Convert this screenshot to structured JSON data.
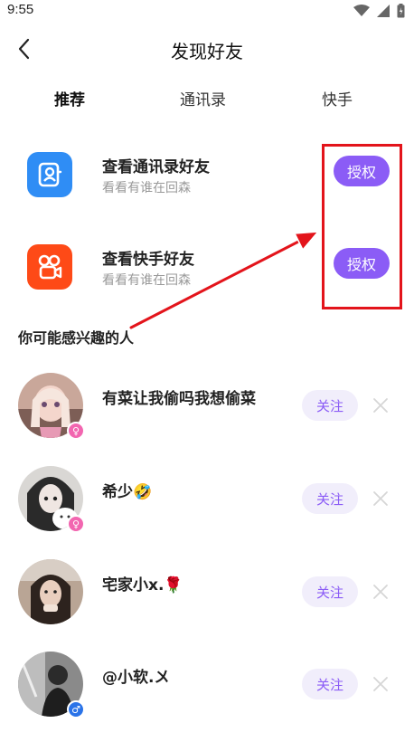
{
  "status_bar": {
    "time": "9:55"
  },
  "header": {
    "title": "发现好友"
  },
  "tabs": [
    {
      "label": "推荐",
      "active": true
    },
    {
      "label": "通讯录",
      "active": false
    },
    {
      "label": "快手",
      "active": false
    }
  ],
  "auth_rows": [
    {
      "title": "查看通讯录好友",
      "subtitle": "看看有谁在回森",
      "button": "授权",
      "icon": "contacts-icon",
      "icon_color": "#2f8df5"
    },
    {
      "title": "查看快手好友",
      "subtitle": "看看有谁在回森",
      "button": "授权",
      "icon": "kuaishou-icon",
      "icon_color": "#fe4a17"
    }
  ],
  "suggest_section_title": "你可能感兴趣的人",
  "suggestions": [
    {
      "name": "有菜让我偷吗我想偷菜",
      "gender": "female",
      "gender_symbol": "♀",
      "follow": "关注"
    },
    {
      "name": "希少🤣",
      "gender": "female",
      "gender_symbol": "♀",
      "follow": "关注"
    },
    {
      "name": "宅家小x.🌹",
      "gender": "none",
      "gender_symbol": "",
      "follow": "关注"
    },
    {
      "name": "@小软.〤",
      "gender": "male",
      "gender_symbol": "♂",
      "follow": "关注"
    }
  ],
  "colors": {
    "accent": "#8b5cf6",
    "highlight": "#e3141b",
    "tab_underline": "#ffe033"
  }
}
